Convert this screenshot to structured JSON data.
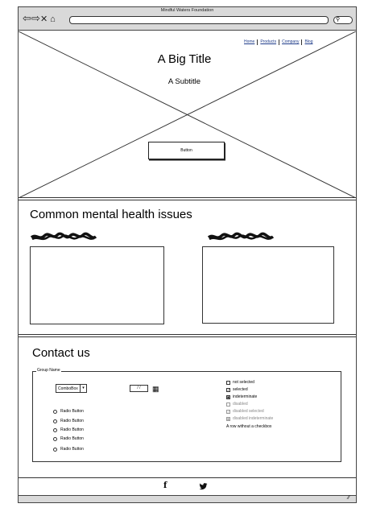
{
  "window": {
    "title": "Mindful Waters Foundation"
  },
  "browser": {
    "back_icon": "arrow-left-icon",
    "forward_icon": "arrow-right-icon",
    "close_icon": "close-icon",
    "home_icon": "home-icon",
    "search_icon": "search-icon"
  },
  "nav": {
    "items": [
      "Home",
      "Products",
      "Company",
      "Blog"
    ]
  },
  "hero": {
    "title": "A Big Title",
    "subtitle": "A Subtitle",
    "button_label": "Button"
  },
  "issues": {
    "title": "Common mental health issues"
  },
  "contact": {
    "title": "Contact us",
    "group_label": "Group Name",
    "combobox_value": "ComboBox",
    "date_value": "/ /",
    "radios": [
      "Radio Button",
      "Radio Button",
      "Radio Button",
      "Radio Button",
      "Radio Button"
    ],
    "checkboxes": [
      {
        "label": "not selected",
        "state": "unchecked"
      },
      {
        "label": "selected",
        "state": "checked"
      },
      {
        "label": "indeterminate",
        "state": "indeterminate"
      },
      {
        "label": "disabled",
        "state": "disabled"
      },
      {
        "label": "disabled selected",
        "state": "disabled-checked"
      },
      {
        "label": "disabled indeterminate",
        "state": "disabled-indeterminate"
      }
    ],
    "no_checkbox_row": "A row without a checkbox"
  },
  "footer": {
    "social_icons": [
      "facebook-icon",
      "twitter-icon"
    ]
  }
}
